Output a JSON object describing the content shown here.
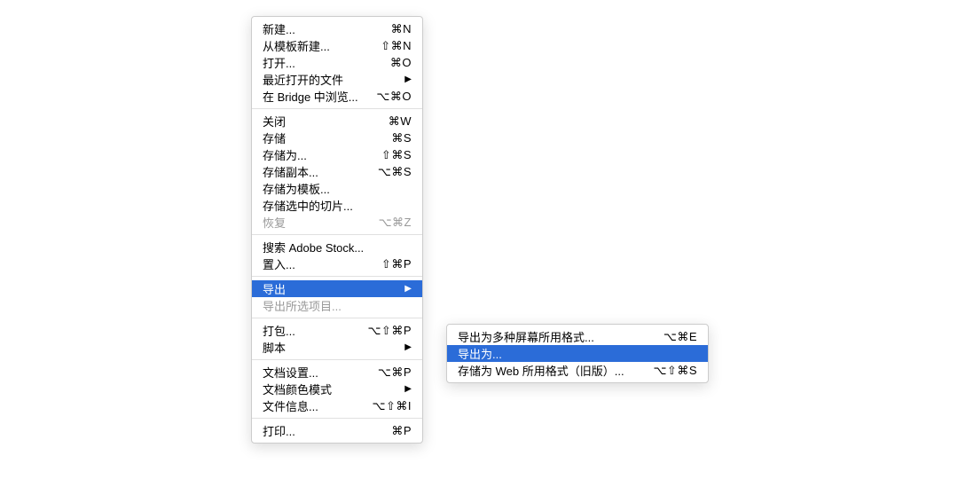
{
  "mainMenu": {
    "groups": [
      [
        {
          "label": "新建...",
          "shortcut": "⌘N",
          "hasSubmenu": false
        },
        {
          "label": "从模板新建...",
          "shortcut": "⇧⌘N",
          "hasSubmenu": false
        },
        {
          "label": "打开...",
          "shortcut": "⌘O",
          "hasSubmenu": false
        },
        {
          "label": "最近打开的文件",
          "shortcut": "",
          "hasSubmenu": true
        },
        {
          "label": "在 Bridge 中浏览...",
          "shortcut": "⌥⌘O",
          "hasSubmenu": false
        }
      ],
      [
        {
          "label": "关闭",
          "shortcut": "⌘W",
          "hasSubmenu": false
        },
        {
          "label": "存储",
          "shortcut": "⌘S",
          "hasSubmenu": false
        },
        {
          "label": "存储为...",
          "shortcut": "⇧⌘S",
          "hasSubmenu": false
        },
        {
          "label": "存储副本...",
          "shortcut": "⌥⌘S",
          "hasSubmenu": false
        },
        {
          "label": "存储为模板...",
          "shortcut": "",
          "hasSubmenu": false
        },
        {
          "label": "存储选中的切片...",
          "shortcut": "",
          "hasSubmenu": false
        },
        {
          "label": "恢复",
          "shortcut": "⌥⌘Z",
          "hasSubmenu": false,
          "disabled": true
        }
      ],
      [
        {
          "label": "搜索 Adobe Stock...",
          "shortcut": "",
          "hasSubmenu": false
        },
        {
          "label": "置入...",
          "shortcut": "⇧⌘P",
          "hasSubmenu": false
        }
      ],
      [
        {
          "label": "导出",
          "shortcut": "",
          "hasSubmenu": true,
          "highlighted": true
        },
        {
          "label": "导出所选项目...",
          "shortcut": "",
          "hasSubmenu": false,
          "disabled": true
        }
      ],
      [
        {
          "label": "打包...",
          "shortcut": "⌥⇧⌘P",
          "hasSubmenu": false
        },
        {
          "label": "脚本",
          "shortcut": "",
          "hasSubmenu": true
        }
      ],
      [
        {
          "label": "文档设置...",
          "shortcut": "⌥⌘P",
          "hasSubmenu": false
        },
        {
          "label": "文档颜色模式",
          "shortcut": "",
          "hasSubmenu": true
        },
        {
          "label": "文件信息...",
          "shortcut": "⌥⇧⌘I",
          "hasSubmenu": false
        }
      ],
      [
        {
          "label": "打印...",
          "shortcut": "⌘P",
          "hasSubmenu": false
        }
      ]
    ]
  },
  "subMenu": {
    "items": [
      {
        "label": "导出为多种屏幕所用格式...",
        "shortcut": "⌥⌘E",
        "highlighted": false
      },
      {
        "label": "导出为...",
        "shortcut": "",
        "highlighted": true
      },
      {
        "label": "存储为 Web 所用格式（旧版）...",
        "shortcut": "⌥⇧⌘S",
        "highlighted": false
      }
    ]
  }
}
